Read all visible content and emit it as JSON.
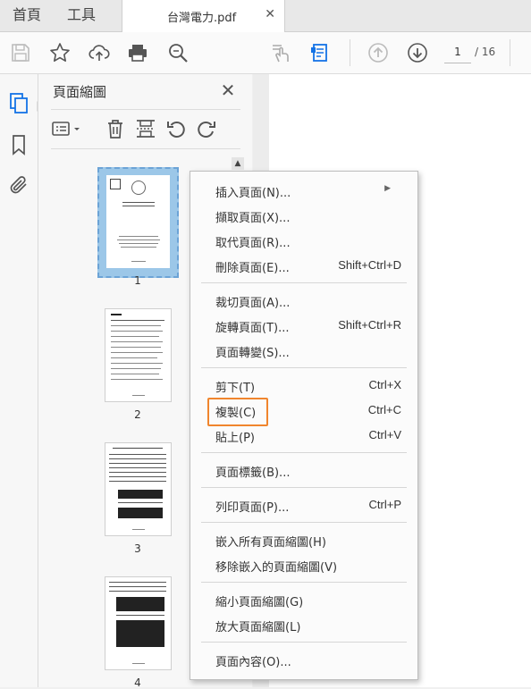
{
  "tabs": {
    "home": "首頁",
    "tools": "工具",
    "document": "台灣電力.pdf",
    "close": "✕"
  },
  "toolbar": {
    "current_page": "1",
    "total_pages": "/ 16",
    "icons": [
      "save-icon",
      "star-icon",
      "upload-cloud-icon",
      "print-icon",
      "zoom-search-icon",
      "touch-mode-icon",
      "fill-sign-icon",
      "page-up-icon",
      "page-down-icon"
    ]
  },
  "rail": {
    "icons": [
      "page-thumbnails-icon",
      "bookmark-icon",
      "attachment-icon"
    ],
    "active_color": "#1473e6"
  },
  "panel": {
    "title": "頁面縮圖",
    "close": "✕",
    "scroll_up": "▲",
    "tools": [
      "options-menu-icon",
      "trash-icon",
      "crop-pages-icon",
      "rotate-ccw-icon",
      "rotate-cw-icon"
    ],
    "thumbnails": [
      {
        "page": "1",
        "selected": true
      },
      {
        "page": "2",
        "selected": false
      },
      {
        "page": "3",
        "selected": false
      },
      {
        "page": "4",
        "selected": false
      }
    ]
  },
  "menu": {
    "items": [
      {
        "label": "插入頁面(N)...",
        "shortcut": "",
        "submenu": true
      },
      {
        "label": "擷取頁面(X)...",
        "shortcut": ""
      },
      {
        "label": "取代頁面(R)...",
        "shortcut": ""
      },
      {
        "label": "刪除頁面(E)...",
        "shortcut": "Shift+Ctrl+D"
      },
      {
        "label": "裁切頁面(A)...",
        "shortcut": ""
      },
      {
        "label": "旋轉頁面(T)...",
        "shortcut": "Shift+Ctrl+R"
      },
      {
        "label": "頁面轉變(S)...",
        "shortcut": ""
      },
      {
        "label": "剪下(T)",
        "shortcut": "Ctrl+X"
      },
      {
        "label": "複製(C)",
        "shortcut": "Ctrl+C"
      },
      {
        "label": "貼上(P)",
        "shortcut": "Ctrl+V"
      },
      {
        "label": "頁面標籤(B)...",
        "shortcut": ""
      },
      {
        "label": "列印頁面(P)...",
        "shortcut": "Ctrl+P"
      },
      {
        "label": "嵌入所有頁面縮圖(H)",
        "shortcut": ""
      },
      {
        "label": "移除嵌入的頁面縮圖(V)",
        "shortcut": ""
      },
      {
        "label": "縮小頁面縮圖(G)",
        "shortcut": ""
      },
      {
        "label": "放大頁面縮圖(L)",
        "shortcut": ""
      },
      {
        "label": "頁面內容(O)...",
        "shortcut": ""
      }
    ],
    "submenu_arrow": "▶",
    "highlight_color": "#f0852d"
  }
}
